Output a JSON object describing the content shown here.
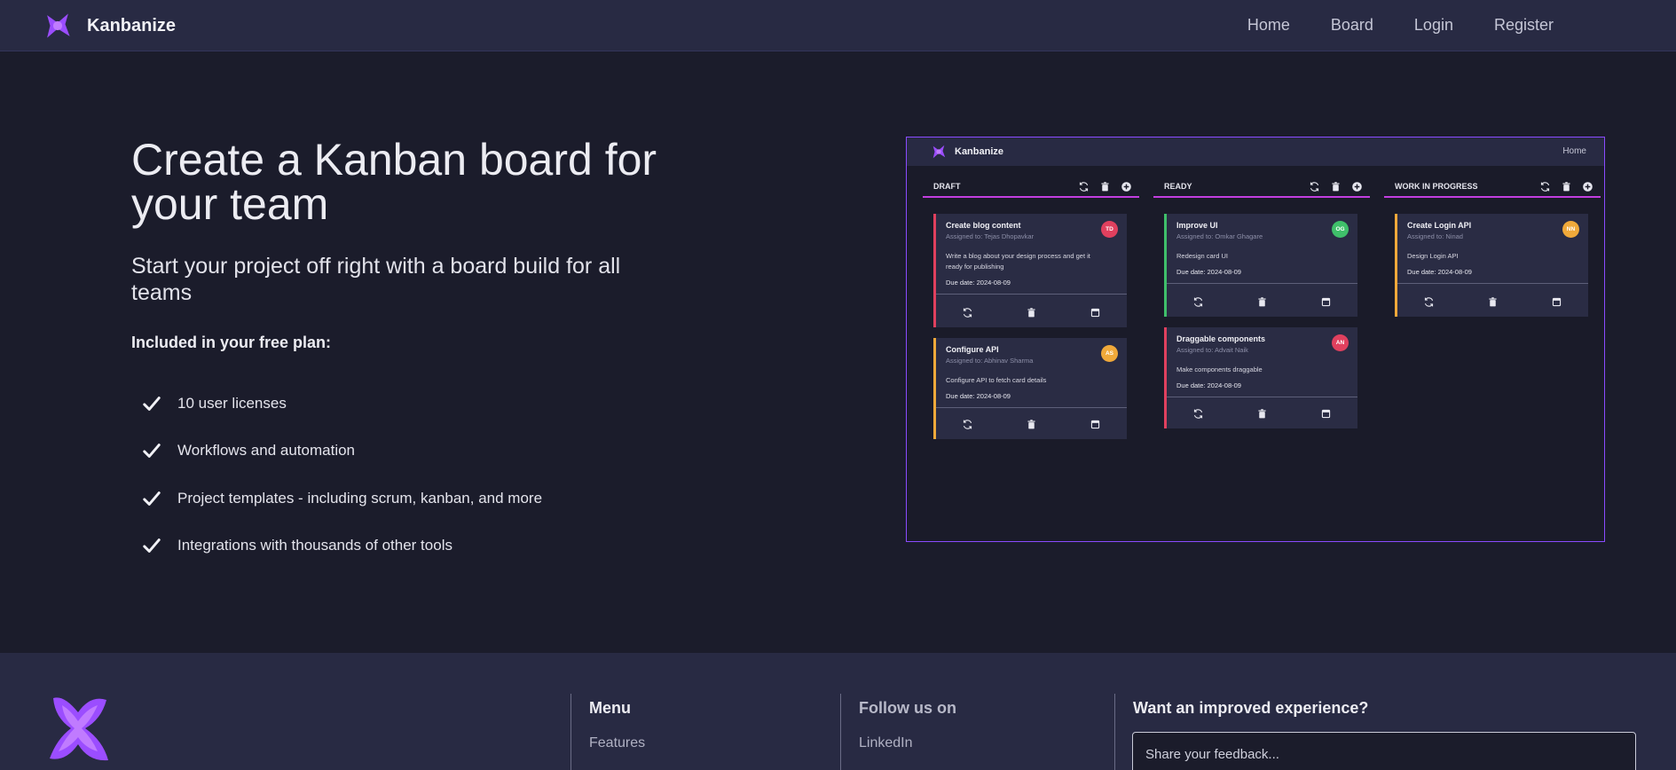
{
  "nav": {
    "brand": "Kanbanize",
    "links": [
      "Home",
      "Board",
      "Login",
      "Register"
    ]
  },
  "hero": {
    "title": "Create a Kanban board for your team",
    "subtitle": "Start your project off right with a board build for all teams",
    "plan_heading": "Included in your free plan:",
    "features": [
      "10 user licenses",
      "Workflows and automation",
      "Project templates - including scrum, kanban, and more",
      "Integrations with thousands of other tools"
    ]
  },
  "preview": {
    "brand": "Kanbanize",
    "nav_home": "Home",
    "columns": [
      {
        "title": "DRAFT",
        "cards": [
          {
            "title": "Create blog content",
            "assigned": "Assigned to: Tejas Dhopavkar",
            "description": "Write a blog about your design process and get it ready for publishing",
            "due": "Due date: 2024-08-09",
            "initials": "TD",
            "avatar_color": "#e0405e",
            "accent": "#e0405e"
          },
          {
            "title": "Configure API",
            "assigned": "Assigned to: Abhinav Sharma",
            "description": "Configure API to fetch card details",
            "due": "Due date: 2024-08-09",
            "initials": "AS",
            "avatar_color": "#f0a93a",
            "accent": "#f0a93a"
          }
        ]
      },
      {
        "title": "READY",
        "cards": [
          {
            "title": "Improve UI",
            "assigned": "Assigned to: Omkar Ghagare",
            "description": "Redesign card UI",
            "due": "Due date: 2024-08-09",
            "initials": "OG",
            "avatar_color": "#3fbf6a",
            "accent": "#3fbf6a"
          },
          {
            "title": "Draggable components",
            "assigned": "Assigned to: Advait Naik",
            "description": "Make components draggable",
            "due": "Due date: 2024-08-09",
            "initials": "AN",
            "avatar_color": "#e0405e",
            "accent": "#e0405e"
          }
        ]
      },
      {
        "title": "WORK IN PROGRESS",
        "cards": [
          {
            "title": "Create Login API",
            "assigned": "Assigned to: Ninad",
            "description": "Design Login API",
            "due": "Due date: 2024-08-09",
            "initials": "NN",
            "avatar_color": "#f0a93a",
            "accent": "#f0a93a"
          }
        ]
      }
    ]
  },
  "footer": {
    "menu_title": "Menu",
    "menu_link": "Features",
    "follow_title": "Follow us on",
    "follow_link": "LinkedIn",
    "feedback_title": "Want an improved experience?",
    "feedback_placeholder": "Share your feedback..."
  },
  "colors": {
    "background": "#1b1c2b",
    "navbar": "#282a43",
    "accent_purple": "#8a4bff",
    "column_underline": "#c23ee0"
  }
}
